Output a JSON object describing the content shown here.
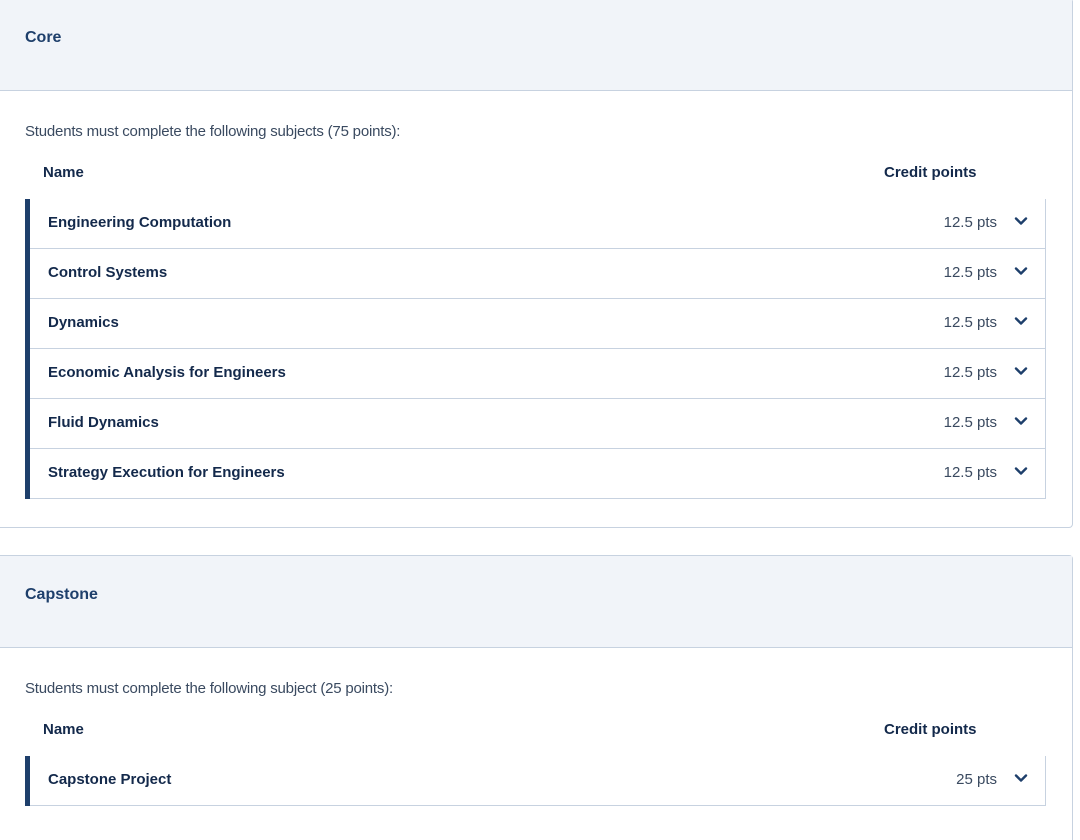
{
  "sections": [
    {
      "title": "Core",
      "intro": "Students must complete the following subjects (75 points):",
      "col_name": "Name",
      "col_credit": "Credit points",
      "subjects": [
        {
          "name": "Engineering Computation",
          "points": "12.5 pts"
        },
        {
          "name": "Control Systems",
          "points": "12.5 pts"
        },
        {
          "name": "Dynamics",
          "points": "12.5 pts"
        },
        {
          "name": "Economic Analysis for Engineers",
          "points": "12.5 pts"
        },
        {
          "name": "Fluid Dynamics",
          "points": "12.5 pts"
        },
        {
          "name": "Strategy Execution for Engineers",
          "points": "12.5 pts"
        }
      ]
    },
    {
      "title": "Capstone",
      "intro": "Students must complete the following subject (25 points):",
      "col_name": "Name",
      "col_credit": "Credit points",
      "subjects": [
        {
          "name": "Capstone Project",
          "points": "25 pts"
        }
      ]
    }
  ],
  "icons": {
    "expand": "chevron-down-icon"
  },
  "colors": {
    "accent": "#1e3f6b",
    "header_bg": "#f1f4f9",
    "border": "#c7d2e0"
  }
}
